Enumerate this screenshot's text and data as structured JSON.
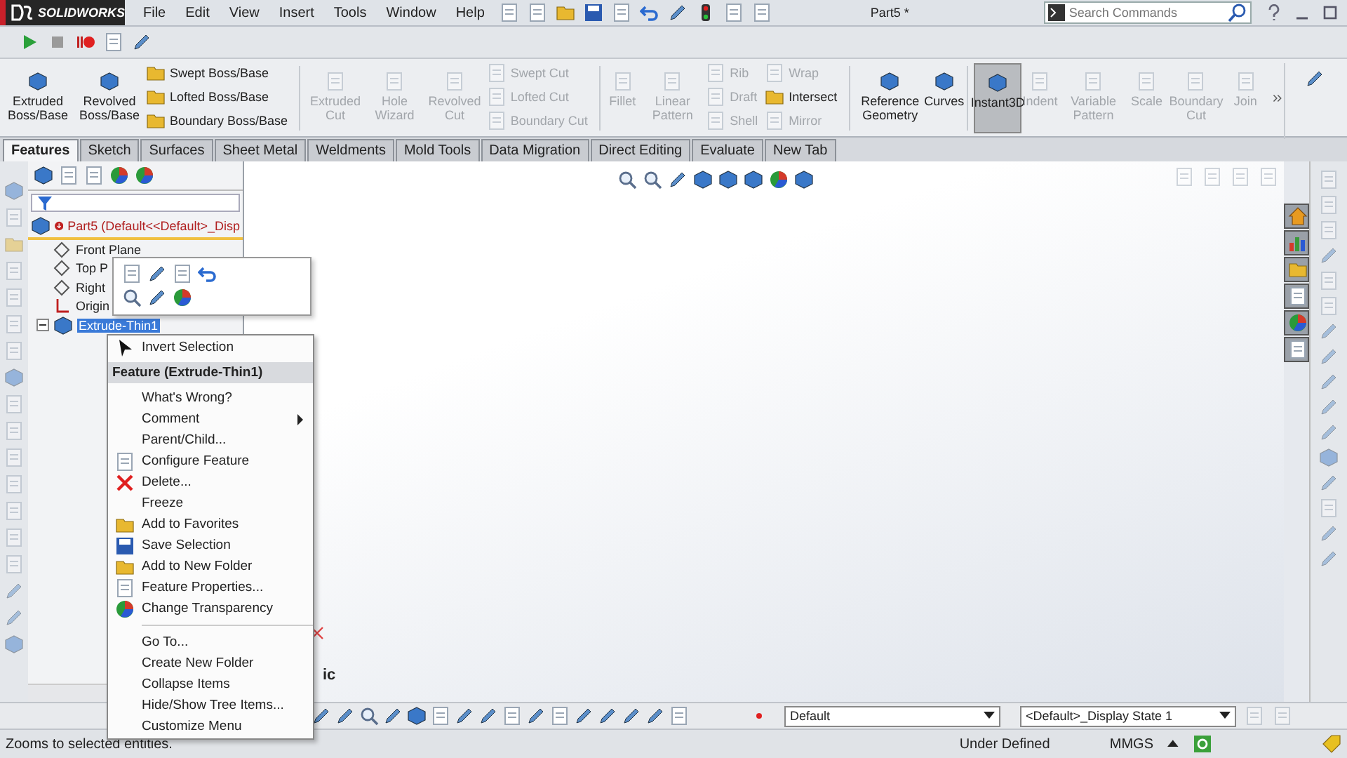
{
  "app_name": "SOLIDWORKS",
  "menu": [
    "File",
    "Edit",
    "View",
    "Insert",
    "Tools",
    "Window",
    "Help"
  ],
  "document_title": "Part5 *",
  "search": {
    "placeholder": "Search Commands"
  },
  "ribbon": [
    [
      {
        "kind": "large",
        "items": [
          {
            "label": "Extruded Boss/Base",
            "disabled": false,
            "selected": false
          },
          {
            "label": "Revolved Boss/Base",
            "disabled": false,
            "selected": false
          }
        ]
      },
      {
        "kind": "stack",
        "items": [
          {
            "label": "Swept Boss/Base",
            "disabled": false
          },
          {
            "label": "Lofted Boss/Base",
            "disabled": false
          },
          {
            "label": "Boundary Boss/Base",
            "disabled": false
          }
        ]
      }
    ],
    [
      {
        "kind": "large",
        "items": [
          {
            "label": "Extruded Cut",
            "disabled": true,
            "selected": false
          },
          {
            "label": "Hole Wizard",
            "disabled": true,
            "selected": false
          },
          {
            "label": "Revolved Cut",
            "disabled": true,
            "selected": false
          }
        ]
      },
      {
        "kind": "stack",
        "items": [
          {
            "label": "Swept Cut",
            "disabled": true
          },
          {
            "label": "Lofted Cut",
            "disabled": true
          },
          {
            "label": "Boundary Cut",
            "disabled": true
          }
        ]
      }
    ],
    [
      {
        "kind": "large",
        "items": [
          {
            "label": "Fillet",
            "disabled": true,
            "selected": false
          },
          {
            "label": "Linear Pattern",
            "disabled": true,
            "selected": false
          }
        ]
      },
      {
        "kind": "stack",
        "items": [
          {
            "label": "Rib",
            "disabled": true
          },
          {
            "label": "Draft",
            "disabled": true
          },
          {
            "label": "Shell",
            "disabled": true
          }
        ]
      },
      {
        "kind": "stack",
        "items": [
          {
            "label": "Wrap",
            "disabled": true
          },
          {
            "label": "Intersect",
            "disabled": false
          },
          {
            "label": "Mirror",
            "disabled": true
          }
        ]
      }
    ],
    [
      {
        "kind": "large",
        "items": [
          {
            "label": "Reference Geometry",
            "disabled": false,
            "selected": false
          },
          {
            "label": "Curves",
            "disabled": false,
            "selected": false
          }
        ]
      }
    ],
    [
      {
        "kind": "large",
        "items": [
          {
            "label": "Instant3D",
            "disabled": false,
            "selected": true
          },
          {
            "label": "Indent",
            "disabled": true,
            "selected": false
          },
          {
            "label": "Variable Pattern",
            "disabled": true,
            "selected": false
          },
          {
            "label": "Scale",
            "disabled": true,
            "selected": false
          },
          {
            "label": "Boundary Cut",
            "disabled": true,
            "selected": false
          },
          {
            "label": "Join",
            "disabled": true,
            "selected": false
          }
        ]
      }
    ]
  ],
  "tabs": [
    {
      "label": "Features",
      "selected": true
    },
    {
      "label": "Sketch",
      "selected": false
    },
    {
      "label": "Surfaces",
      "selected": false
    },
    {
      "label": "Sheet Metal",
      "selected": false
    },
    {
      "label": "Weldments",
      "selected": false
    },
    {
      "label": "Mold Tools",
      "selected": false
    },
    {
      "label": "Data Migration",
      "selected": false
    },
    {
      "label": "Direct Editing",
      "selected": false
    },
    {
      "label": "Evaluate",
      "selected": false
    },
    {
      "label": "New Tab",
      "selected": false
    }
  ],
  "tree": {
    "label": "Part5  (Default<<Default>_Disp",
    "children": [
      {
        "label": "Front Plane",
        "kind": "plane",
        "selected": false,
        "expanded": false
      },
      {
        "label": "Top P",
        "kind": "plane",
        "selected": false,
        "expanded": false
      },
      {
        "label": "Right",
        "kind": "plane",
        "selected": false,
        "expanded": false
      },
      {
        "label": "Origin",
        "kind": "origin",
        "selected": false,
        "expanded": false
      },
      {
        "label": "Extrude-Thin1",
        "kind": "feature",
        "selected": true,
        "expanded": true
      }
    ]
  },
  "view_label": "ic",
  "context_menu": [
    {
      "kind": "item",
      "label": "Invert Selection",
      "submenu": false
    },
    {
      "kind": "header",
      "label": "Feature (Extrude-Thin1)"
    },
    {
      "kind": "item",
      "label": "What's Wrong?",
      "submenu": false
    },
    {
      "kind": "item",
      "label": "Comment",
      "submenu": true
    },
    {
      "kind": "item",
      "label": "Parent/Child...",
      "submenu": false
    },
    {
      "kind": "item",
      "label": "Configure Feature",
      "submenu": false
    },
    {
      "kind": "item",
      "label": "Delete...",
      "submenu": false
    },
    {
      "kind": "item",
      "label": "Freeze",
      "submenu": false
    },
    {
      "kind": "item",
      "label": "Add to Favorites",
      "submenu": false
    },
    {
      "kind": "item",
      "label": "Save Selection",
      "submenu": false
    },
    {
      "kind": "item",
      "label": "Add to New Folder",
      "submenu": false
    },
    {
      "kind": "item",
      "label": "Feature Properties...",
      "submenu": false
    },
    {
      "kind": "item",
      "label": "Change Transparency",
      "submenu": false
    },
    {
      "kind": "separator"
    },
    {
      "kind": "item",
      "label": "Go To...",
      "submenu": false
    },
    {
      "kind": "item",
      "label": "Create New Folder",
      "submenu": false
    },
    {
      "kind": "item",
      "label": "Collapse Items",
      "submenu": false
    },
    {
      "kind": "item",
      "label": "Hide/Show Tree Items...",
      "submenu": false
    },
    {
      "kind": "item",
      "label": "Customize Menu",
      "submenu": false
    }
  ],
  "bottom_dropdowns": [
    "Default",
    "<Default>_Display State 1"
  ],
  "status_bar": {
    "message": "Zooms to selected entities.",
    "state": "Under Defined",
    "units": "MMGS"
  }
}
